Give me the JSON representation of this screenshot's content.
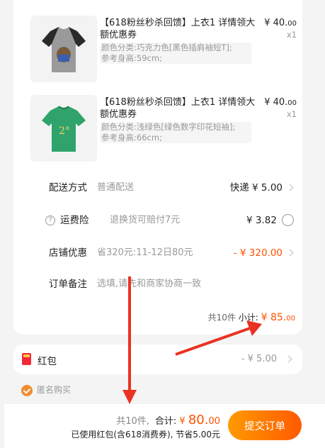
{
  "products": [
    {
      "title": "【618粉丝秒杀回馈】上衣1 详情领大额优惠券",
      "spec_line1": "颜色分类:巧克力色[黑色插肩袖短T];",
      "spec_line2": "参考身高:59cm;",
      "price_main": "¥ 40.",
      "price_cents": "00",
      "qty": "x1",
      "shirt_color": "#9a9a9a",
      "sleeve_color": "#2a2a2a"
    },
    {
      "title": "【618粉丝秒杀回馈】上衣1 详情领大额优惠券",
      "spec_line1": "颜色分类:浅绿色[绿色数字印花短袖];",
      "spec_line2": "参考身高:66cm;",
      "price_main": "¥ 40.",
      "price_cents": "00",
      "qty": "x1",
      "shirt_color": "#2fa36b",
      "sleeve_color": "#2fa36b",
      "print_text": "2°"
    }
  ],
  "rows": {
    "delivery": {
      "label": "配送方式",
      "desc": "普通配送",
      "value": "快递 ¥ 5.00"
    },
    "insurance": {
      "label": "运费险",
      "desc": "退换货可赔付7元",
      "value": "¥ 3.82",
      "help_glyph": "?"
    },
    "discount": {
      "label": "店铺优惠",
      "desc": "省320元:11-12日80元",
      "value": "- ¥ 320.00"
    },
    "note": {
      "label": "订单备注",
      "placeholder": "选填,请先和商家协商一致"
    }
  },
  "subtotal": {
    "count_text": "共10件",
    "label": "小计:",
    "amount_main": "¥ 85.",
    "amount_cents": "00"
  },
  "redpack": {
    "label": "红包",
    "value": "- ¥ 5.00"
  },
  "anonymous": {
    "label": "匿名购买",
    "checked": true
  },
  "bottom": {
    "count_text": "共10件,",
    "total_label": "合计:",
    "total_prefix": "¥ ",
    "total_main": "80.",
    "total_cents": "00",
    "saving_text": "已使用红包(含618消费券), 节省5.00元",
    "submit_label": "提交订单"
  },
  "colors": {
    "accent": "#ff5000",
    "annotation_red": "#ea3223"
  }
}
